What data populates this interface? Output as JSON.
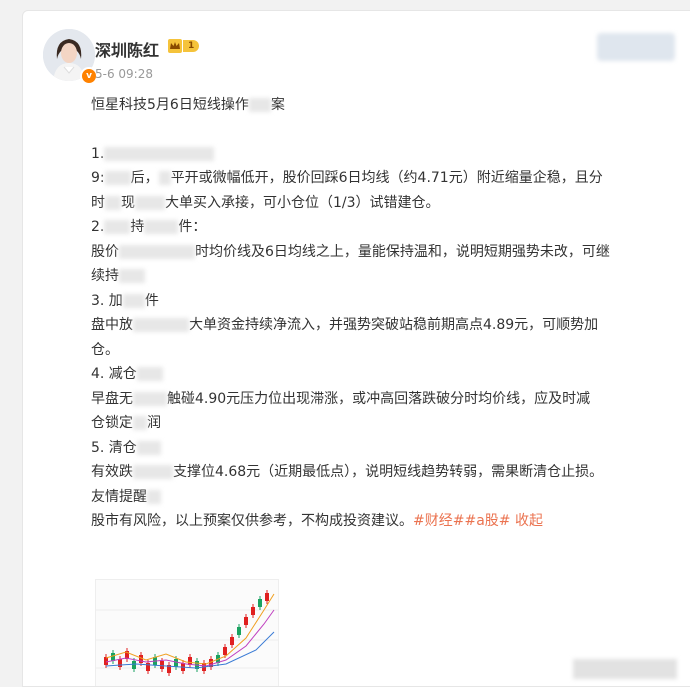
{
  "post": {
    "author": "深圳陈红",
    "level": "1",
    "time": "5-6 09:28",
    "title": "恒星科技5月6日短线操作",
    "title_tail": "案",
    "s1_head": "1.",
    "s1_a": "9:",
    "s1_b": "后，",
    "s1_c": "平开或微幅低开，股价回踩6日均线（约4.71元）附近缩量企稳，且分",
    "s1_d": "时",
    "s1_e": "现",
    "s1_f": "大单买入承接，可小仓位（1/3）试错建仓。",
    "s2_head": "2.",
    "s2_a": "持",
    "s2_b": "件：",
    "s2_c": "股价",
    "s2_d": "时均价线及6日均线之上，量能保持温和，说明短期强势未改，可继",
    "s2_e": "续持",
    "s3_head": "3. 加",
    "s3_b": "件",
    "s3_c": "盘中放",
    "s3_d": "大单资金持续净流入，并强势突破站稳前期高点4.89元，可顺势加",
    "s3_e": "仓。",
    "s4_head": "4. 减仓",
    "s4_c": "早盘无",
    "s4_d": "触碰4.90元压力位出现滞涨，或冲高回落跌破分时均价线，应及时减",
    "s4_e": "仓锁定",
    "s4_f": "润",
    "s5_head": "5. 清仓",
    "s5_c": "有效跌",
    "s5_d": "支撑位4.68元（近期最低点），说明短线趋势转弱，需果断清仓止损。",
    "tip_head": "友情提醒",
    "disclaimer": "股市有风险，以上预案仅供参考，不构成投资建议。",
    "tags": "#财经##a股#",
    "collapse": "收起"
  },
  "colors": {
    "accent": "#eb7350",
    "badge": "#ff8200",
    "up": "#e02020",
    "down": "#1aa260"
  }
}
